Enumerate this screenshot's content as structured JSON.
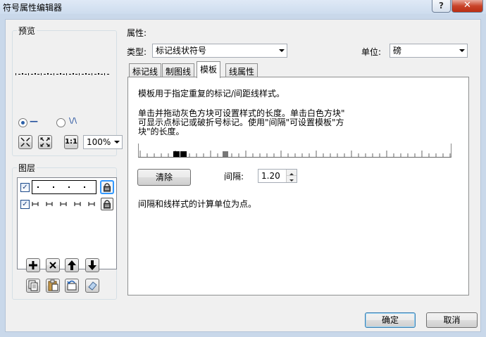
{
  "window": {
    "title": "符号属性编辑器",
    "help_label": "?",
    "close_label": "✕"
  },
  "preview": {
    "group_label": "预览",
    "zoom_value": "100%",
    "fit_label": "1:1",
    "mode_line_glyph": "—",
    "mode_wave_glyph": "\\/\\"
  },
  "layers": {
    "group_label": "图层",
    "items": [
      {
        "checked": true,
        "preview": "dots",
        "selected": true
      },
      {
        "checked": true,
        "preview": "bars",
        "selected": false
      }
    ]
  },
  "properties": {
    "section_label": "属性:",
    "type_label": "类型:",
    "type_value": "标记线状符号",
    "unit_label": "单位:",
    "unit_value": "磅"
  },
  "tabs": [
    {
      "label": "标记线",
      "active": false
    },
    {
      "label": "制图线",
      "active": false
    },
    {
      "label": "模板",
      "active": true
    },
    {
      "label": "线属性",
      "active": false
    }
  ],
  "template_tab": {
    "intro": "模板用于指定重复的标记/间距线样式。",
    "instructions_line1": "单击并拖动灰色方块可设置样式的长度。单击白色方块\"",
    "instructions_line2": "可显示点标记或破折号标记。使用\"间隔\"可设置模板\"方",
    "instructions_line3": "块\"的长度。",
    "clear_label": "清除",
    "interval_label": "间隔:",
    "interval_value": "1.20",
    "footnote": "间隔和线样式的计算单位为点。"
  },
  "dialog_buttons": {
    "ok_label": "确定",
    "cancel_label": "取消"
  },
  "colors": {
    "selection_border": "#3399ff",
    "close_red": "#c9442a",
    "dialog_background": "#f0f0f0"
  }
}
